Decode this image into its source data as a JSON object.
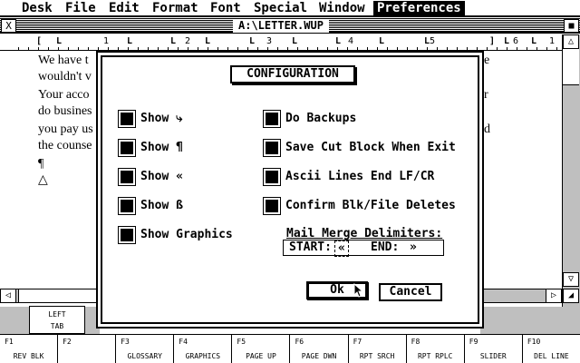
{
  "menubar": {
    "items": [
      "Desk",
      "File",
      "Edit",
      "Format",
      "Font",
      "Special",
      "Window",
      "Preferences"
    ]
  },
  "window": {
    "title": "A:\\LETTER.WUP",
    "close_glyph": "X",
    "full_glyph": "■"
  },
  "ruler": {
    "marks": [
      "[",
      "L",
      "L",
      "L",
      "L",
      "L",
      "L",
      "L",
      "L",
      "L",
      "]",
      "L",
      "L"
    ],
    "numbers": [
      "1",
      "2",
      "3",
      "4",
      "5",
      "6",
      "1"
    ]
  },
  "document": {
    "lines": [
      "We have t",
      "wouldn't v",
      "Your acco",
      "do busines",
      "you pay us",
      "the counse",
      "¶",
      "△"
    ],
    "right_fragments": [
      "e",
      "r",
      "d"
    ]
  },
  "scroll": {
    "up": "△",
    "down": "▽",
    "left": "◁",
    "right": "▷",
    "size": "◢"
  },
  "left_tab": {
    "line1": "LEFT",
    "line2": "TAB"
  },
  "function_keys": [
    {
      "key": "F1",
      "label": "REV BLK"
    },
    {
      "key": "F2",
      "label": ""
    },
    {
      "key": "F3",
      "label": "GLOSSARY"
    },
    {
      "key": "F4",
      "label": "GRAPHICS"
    },
    {
      "key": "F5",
      "label": "PAGE UP"
    },
    {
      "key": "F6",
      "label": "PAGE DWN"
    },
    {
      "key": "F7",
      "label": "RPT SRCH"
    },
    {
      "key": "F8",
      "label": "RPT RPLC"
    },
    {
      "key": "F9",
      "label": "SLIDER"
    },
    {
      "key": "F10",
      "label": "DEL LINE"
    }
  ],
  "dialog": {
    "title": "CONFIGURATION",
    "left_options": [
      {
        "label": "Show ⤷",
        "checked": true
      },
      {
        "label": "Show ¶",
        "checked": true
      },
      {
        "label": "Show «",
        "checked": true
      },
      {
        "label": "Show ß",
        "checked": true
      },
      {
        "label": "Show Graphics",
        "checked": true
      }
    ],
    "right_options": [
      {
        "label": "Do Backups",
        "checked": true
      },
      {
        "label": "Save Cut Block When Exit",
        "checked": true
      },
      {
        "label": "Ascii Lines End LF/CR",
        "checked": true
      },
      {
        "label": "Confirm Blk/File Deletes",
        "checked": true
      }
    ],
    "mail_merge": {
      "title": "Mail Merge Delimiters:",
      "start_label": "START:",
      "start_value": "«",
      "end_label": "END:",
      "end_value": "»"
    },
    "ok_label": "Ok",
    "cancel_label": "Cancel"
  }
}
